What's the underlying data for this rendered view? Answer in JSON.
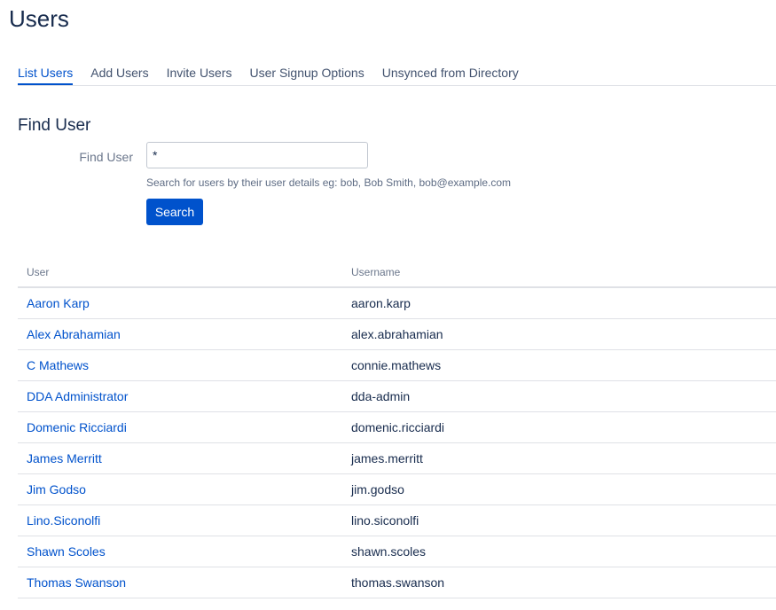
{
  "page": {
    "title": "Users"
  },
  "tabs": [
    {
      "label": "List Users",
      "active": true
    },
    {
      "label": "Add Users",
      "active": false
    },
    {
      "label": "Invite Users",
      "active": false
    },
    {
      "label": "User Signup Options",
      "active": false
    },
    {
      "label": "Unsynced from Directory",
      "active": false
    }
  ],
  "find_user": {
    "section_title": "Find User",
    "field_label": "Find User",
    "input_value": "*",
    "help_text": "Search for users by their user details eg: bob, Bob Smith, bob@example.com",
    "button_label": "Search"
  },
  "table": {
    "headers": {
      "user": "User",
      "username": "Username"
    },
    "rows": [
      {
        "user": "Aaron Karp",
        "username": "aaron.karp"
      },
      {
        "user": "Alex Abrahamian",
        "username": "alex.abrahamian"
      },
      {
        "user": "C Mathews",
        "username": "connie.mathews"
      },
      {
        "user": "DDA Administrator",
        "username": "dda-admin"
      },
      {
        "user": "Domenic Ricciardi",
        "username": "domenic.ricciardi"
      },
      {
        "user": "James Merritt",
        "username": "james.merritt"
      },
      {
        "user": "Jim Godso",
        "username": "jim.godso"
      },
      {
        "user": "Lino.Siconolfi",
        "username": "lino.siconolfi"
      },
      {
        "user": "Shawn Scoles",
        "username": "shawn.scoles"
      },
      {
        "user": "Thomas Swanson",
        "username": "thomas.swanson"
      }
    ]
  },
  "colors": {
    "link": "#0052cc",
    "primary_button": "#0052cc",
    "text": "#172b4d",
    "muted": "#6b778c",
    "border": "#dfe1e6"
  }
}
